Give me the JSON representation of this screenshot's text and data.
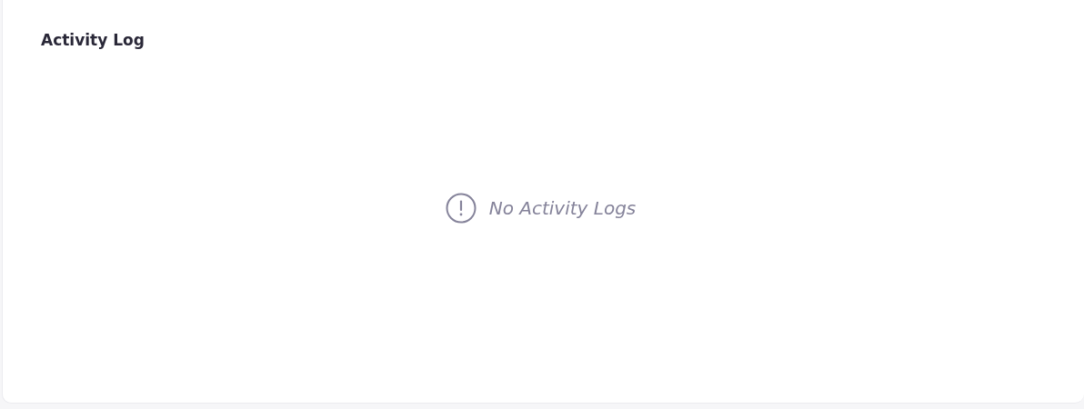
{
  "card": {
    "title": "Activity Log",
    "empty_state": {
      "message": "No Activity Logs"
    }
  }
}
